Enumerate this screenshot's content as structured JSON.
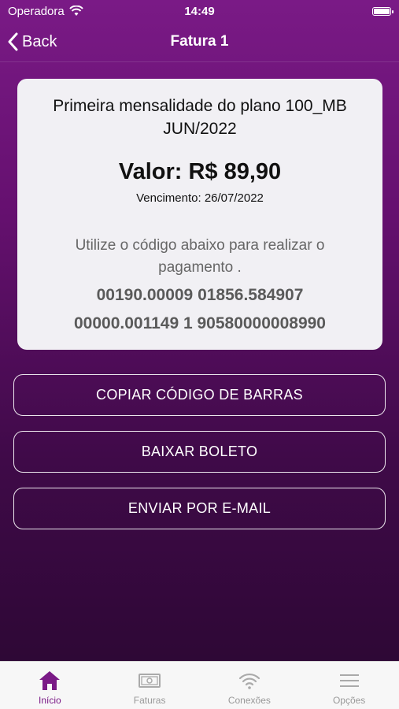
{
  "status": {
    "carrier": "Operadora",
    "time": "14:49"
  },
  "nav": {
    "back_label": "Back",
    "title": "Fatura 1"
  },
  "invoice": {
    "description": "Primeira mensalidade do plano 100_MB JUN/2022",
    "amount": "Valor: R$ 89,90",
    "due_date": "Vencimento: 26/07/2022",
    "instructions": "Utilize o código abaixo para realizar o pagamento .",
    "barcode_line1": "00190.00009 01856.584907",
    "barcode_line2": "00000.001149 1 90580000008990"
  },
  "actions": {
    "copy_label": "COPIAR CÓDIGO DE BARRAS",
    "download_label": "BAIXAR BOLETO",
    "email_label": "ENVIAR POR E-MAIL"
  },
  "tabs": [
    {
      "label": "Início",
      "icon": "home-icon",
      "active": true
    },
    {
      "label": "Faturas",
      "icon": "bill-icon",
      "active": false
    },
    {
      "label": "Conexões",
      "icon": "wifi-icon",
      "active": false
    },
    {
      "label": "Opções",
      "icon": "menu-icon",
      "active": false
    }
  ],
  "colors": {
    "accent": "#7a1a86",
    "card": "#f1f0f4"
  }
}
